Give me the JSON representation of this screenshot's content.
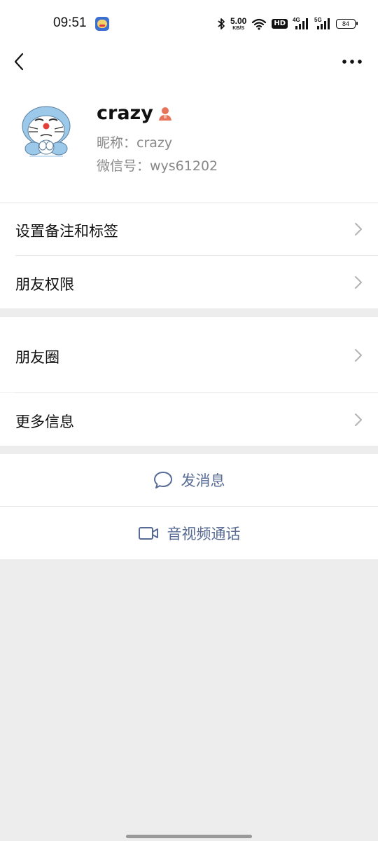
{
  "status_bar": {
    "time": "09:51",
    "net_speed_value": "5.00",
    "net_speed_unit": "KB/S",
    "hd_label": "HD",
    "signal1_tag": "4G",
    "signal2_tag": "5G",
    "battery": "84",
    "icons": [
      "app-icon",
      "bluetooth-icon",
      "wifi-icon",
      "signal-icon",
      "battery-icon"
    ]
  },
  "nav": {
    "back_icon": "chevron-left-icon",
    "more_icon": "more-horizontal-icon"
  },
  "profile": {
    "name": "crazy",
    "nickname": "昵称：crazy",
    "wechat_id": "微信号：wys61202",
    "avatar": "doraemon-avatar",
    "badge_icon": "person-icon"
  },
  "rows": {
    "remark_tags": "设置备注和标签",
    "friend_permissions": "朋友权限",
    "moments": "朋友圈",
    "more_info": "更多信息"
  },
  "actions": {
    "send_message": "发消息",
    "av_call": "音视频通话"
  },
  "colors": {
    "accent_link": "#576b95",
    "background": "#ededed",
    "card": "#ffffff",
    "badge": "#e8735a"
  }
}
